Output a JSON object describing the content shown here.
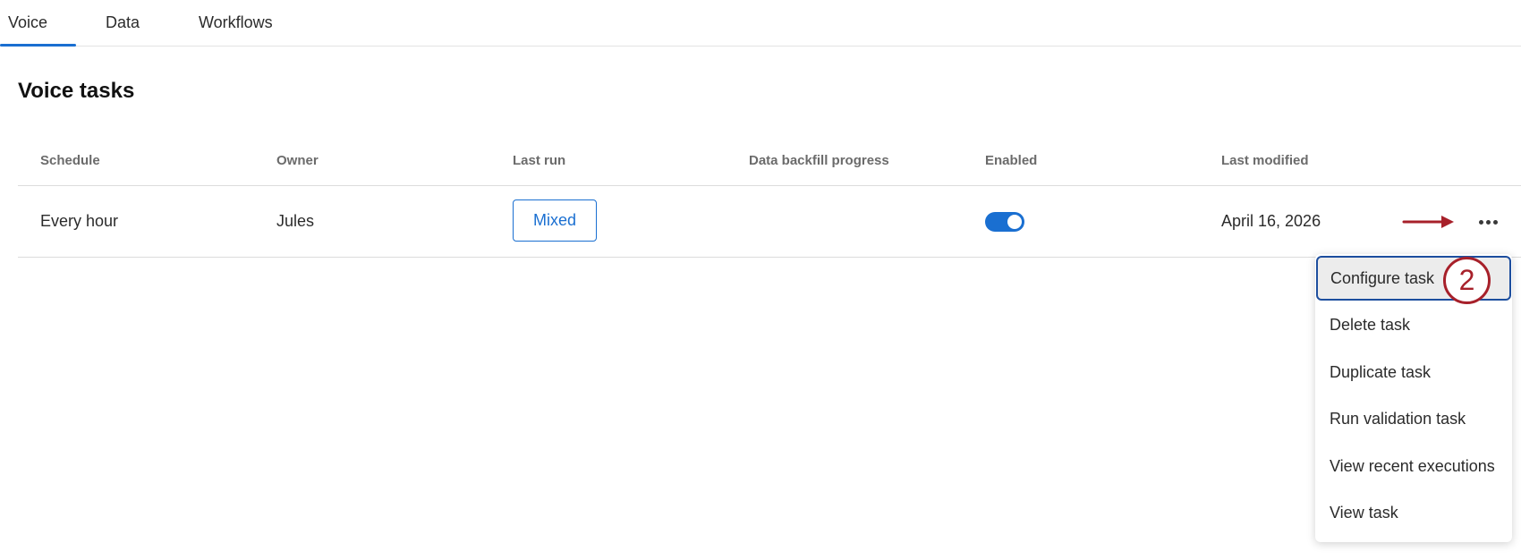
{
  "tabs": [
    {
      "label": "Voice",
      "active": true
    },
    {
      "label": "Data",
      "active": false
    },
    {
      "label": "Workflows",
      "active": false
    }
  ],
  "page_title": "Voice tasks",
  "table": {
    "columns": [
      "Schedule",
      "Owner",
      "Last run",
      "Data backfill progress",
      "Enabled",
      "Last modified"
    ],
    "rows": [
      {
        "schedule": "Every hour",
        "owner": "Jules",
        "last_run": "Mixed",
        "data_backfill_progress": "",
        "enabled": true,
        "last_modified": "April 16, 2026"
      }
    ]
  },
  "actions_menu": {
    "items": [
      {
        "label": "Configure task",
        "highlighted": true
      },
      {
        "label": "Delete task",
        "highlighted": false
      },
      {
        "label": "Duplicate task",
        "highlighted": false
      },
      {
        "label": "Run validation task",
        "highlighted": false
      },
      {
        "label": "View recent executions",
        "highlighted": false
      },
      {
        "label": "View task",
        "highlighted": false
      }
    ]
  },
  "annotation": {
    "step_number": "2"
  },
  "colors": {
    "accent": "#1a6fd1",
    "annotation": "#a7202a",
    "menu_highlight_border": "#1d4e9e"
  }
}
